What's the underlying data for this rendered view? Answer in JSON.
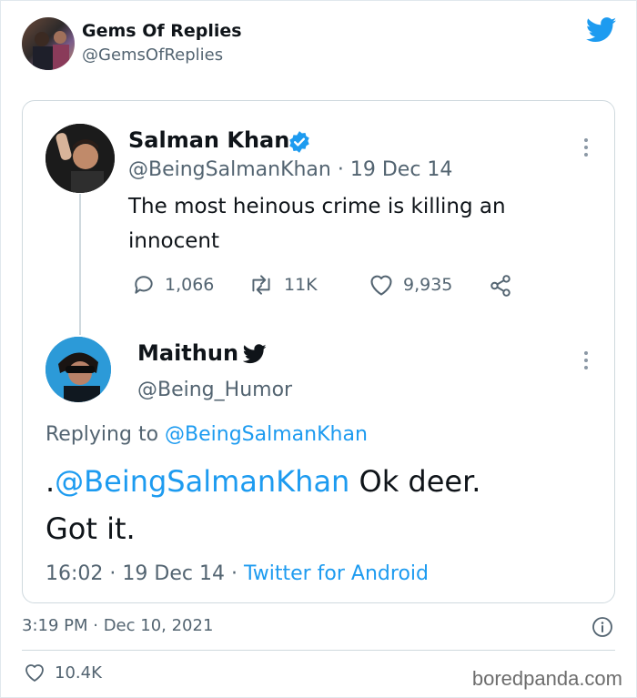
{
  "account": {
    "name": "Gems Of Replies",
    "handle": "@GemsOfReplies"
  },
  "original_tweet": {
    "name": "Salman Khan",
    "handle": "@BeingSalmanKhan",
    "date": "19 Dec 14",
    "separator": "·",
    "text_line1": "The most heinous crime is killing an",
    "text_line2": "innocent",
    "replies": "1,066",
    "retweets": "11K",
    "likes": "9,935"
  },
  "reply_tweet": {
    "name": "Maithun",
    "handle": "@Being_Humor",
    "replying_prefix": "Replying to",
    "replying_to": "@BeingSalmanKhan",
    "text_prefix": ".",
    "mention": "@BeingSalmanKhan",
    "text_rest": " Ok deer.",
    "text_line2": "Got it.",
    "time": "16:02",
    "date": "19 Dec 14",
    "separator": "·",
    "source": "Twitter for Android"
  },
  "footer": {
    "timestamp": "3:19 PM · Dec 10, 2021",
    "likes": "10.4K",
    "watermark": "boredpanda.com"
  },
  "colors": {
    "twitter_blue": "#1d9bf0",
    "muted_text": "#536471",
    "border": "#cfd9de"
  },
  "icons": [
    "twitter-bird-icon",
    "verified-badge-icon",
    "reply-icon",
    "retweet-icon",
    "like-icon",
    "share-icon",
    "more-icon",
    "info-icon"
  ]
}
